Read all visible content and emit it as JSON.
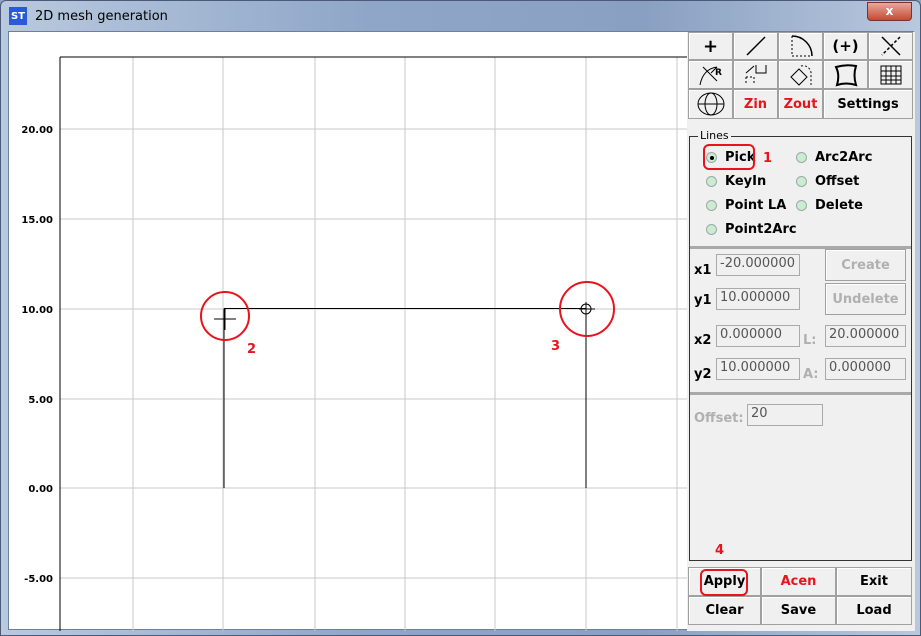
{
  "window": {
    "title": "2D mesh generation",
    "close": "x",
    "logo": "ST"
  },
  "toolbar": {
    "row1": [
      "+",
      "/",
      "arc",
      "(+)",
      "X"
    ],
    "zin": "Zin",
    "zout": "Zout",
    "settings": "Settings"
  },
  "lines_group": {
    "title": "Lines",
    "options": [
      {
        "label": "Pick",
        "selected": true
      },
      {
        "label": "Arc2Arc"
      },
      {
        "label": "KeyIn"
      },
      {
        "label": "Offset"
      },
      {
        "label": "Point LA"
      },
      {
        "label": "Delete"
      },
      {
        "label": "Point2Arc"
      }
    ]
  },
  "fields": {
    "x1_label": "x1",
    "x1": "-20.000000",
    "y1_label": "y1",
    "y1": "10.000000",
    "x2_label": "x2",
    "x2": "0.000000",
    "y2_label": "y2",
    "y2": "10.000000",
    "L_label": "L:",
    "L": "20.000000",
    "A_label": "A:",
    "A": "0.000000",
    "offset_label": "Offset:",
    "offset": "20",
    "create": "Create",
    "undelete": "Undelete"
  },
  "buttons": {
    "apply": "Apply",
    "acen": "Acen",
    "exit": "Exit",
    "clear": "Clear",
    "save": "Save",
    "load": "Load"
  },
  "annotations": [
    "1",
    "2",
    "3",
    "4"
  ],
  "plot": {
    "y_ticks": [
      "20.00",
      "15.00",
      "10.00",
      "5.00",
      "0.00",
      "-5.00"
    ],
    "segments": [
      [
        -20,
        10,
        0,
        10
      ],
      [
        -20,
        10,
        -20,
        0
      ],
      [
        0,
        10,
        0,
        0
      ]
    ]
  }
}
